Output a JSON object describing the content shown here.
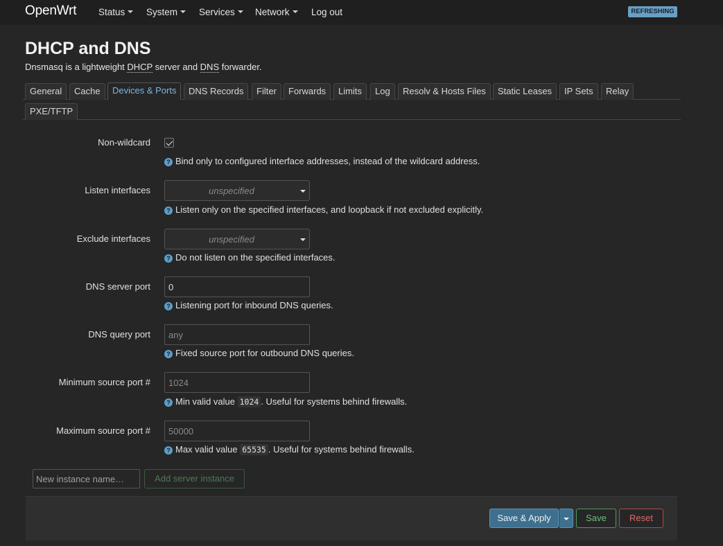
{
  "header": {
    "brand": "OpenWrt",
    "menu": [
      {
        "label": "Status",
        "dropdown": true
      },
      {
        "label": "System",
        "dropdown": true
      },
      {
        "label": "Services",
        "dropdown": true
      },
      {
        "label": "Network",
        "dropdown": true
      },
      {
        "label": "Log out",
        "dropdown": false
      }
    ],
    "badge": "REFRESHING"
  },
  "page": {
    "title": "DHCP and DNS",
    "desc_prefix": "Dnsmasq is a lightweight ",
    "desc_abbr1": "DHCP",
    "desc_mid": " server and ",
    "desc_abbr2": "DNS",
    "desc_suffix": " forwarder."
  },
  "tabs": [
    {
      "label": "General",
      "active": false
    },
    {
      "label": "Cache",
      "active": false
    },
    {
      "label": "Devices & Ports",
      "active": true
    },
    {
      "label": "DNS Records",
      "active": false
    },
    {
      "label": "Filter",
      "active": false
    },
    {
      "label": "Forwards",
      "active": false
    },
    {
      "label": "Limits",
      "active": false
    },
    {
      "label": "Log",
      "active": false
    },
    {
      "label": "Resolv & Hosts Files",
      "active": false
    },
    {
      "label": "Static Leases",
      "active": false
    },
    {
      "label": "IP Sets",
      "active": false
    },
    {
      "label": "Relay",
      "active": false
    },
    {
      "label": "PXE/TFTP",
      "active": false
    }
  ],
  "fields": {
    "nonwildcard": {
      "label": "Non-wildcard",
      "checked": true,
      "help": "Bind only to configured interface addresses, instead of the wildcard address."
    },
    "listen": {
      "label": "Listen interfaces",
      "value": "unspecified",
      "help": "Listen only on the specified interfaces, and loopback if not excluded explicitly."
    },
    "exclude": {
      "label": "Exclude interfaces",
      "value": "unspecified",
      "help": "Do not listen on the specified interfaces."
    },
    "dnsport": {
      "label": "DNS server port",
      "value": "0",
      "help": "Listening port for inbound DNS queries."
    },
    "queryport": {
      "label": "DNS query port",
      "placeholder": "any",
      "help": "Fixed source port for outbound DNS queries."
    },
    "minport": {
      "label": "Minimum source port #",
      "placeholder": "1024",
      "help_prefix": "Min valid value ",
      "help_code": "1024",
      "help_suffix": ". Useful for systems behind firewalls."
    },
    "maxport": {
      "label": "Maximum source port #",
      "placeholder": "50000",
      "help_prefix": "Max valid value ",
      "help_code": "65535",
      "help_suffix": ". Useful for systems behind firewalls."
    }
  },
  "instance": {
    "placeholder": "New instance name…",
    "add_label": "Add server instance"
  },
  "actions": {
    "save_apply": "Save & Apply",
    "save": "Save",
    "reset": "Reset"
  },
  "help_icon": "?"
}
